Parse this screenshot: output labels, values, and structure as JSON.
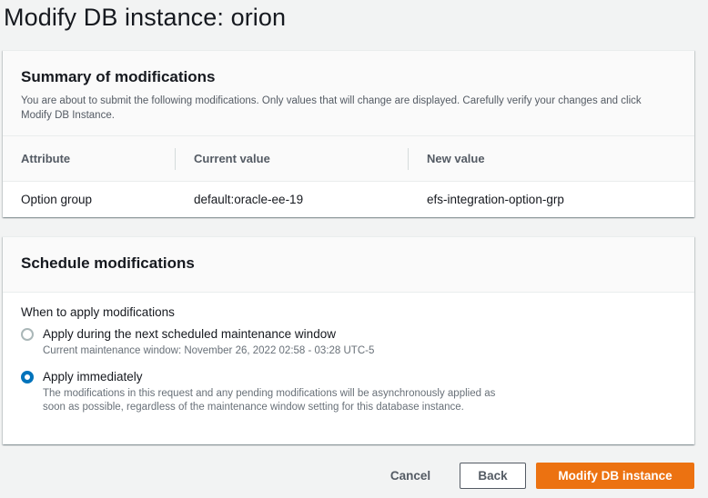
{
  "page": {
    "title": "Modify DB instance: orion"
  },
  "summary": {
    "heading": "Summary of modifications",
    "description": "You are about to submit the following modifications. Only values that will change are displayed. Carefully verify your changes and click Modify DB Instance.",
    "columns": [
      "Attribute",
      "Current value",
      "New value"
    ],
    "rows": [
      {
        "attribute": "Option group",
        "current": "default:oracle-ee-19",
        "new": "efs-integration-option-grp"
      }
    ]
  },
  "schedule": {
    "heading": "Schedule modifications",
    "field_label": "When to apply modifications",
    "options": [
      {
        "label": "Apply during the next scheduled maintenance window",
        "description": "Current maintenance window: November 26, 2022 02:58 - 03:28 UTC-5",
        "selected": false
      },
      {
        "label": "Apply immediately",
        "description": "The modifications in this request and any pending modifications will be asynchronously applied as soon as possible, regardless of the maintenance window setting for this database instance.",
        "selected": true
      }
    ]
  },
  "actions": {
    "cancel_label": "Cancel",
    "back_label": "Back",
    "submit_label": "Modify DB instance"
  },
  "colors": {
    "primary": "#ec7211",
    "radio_selected": "#0073bb"
  }
}
